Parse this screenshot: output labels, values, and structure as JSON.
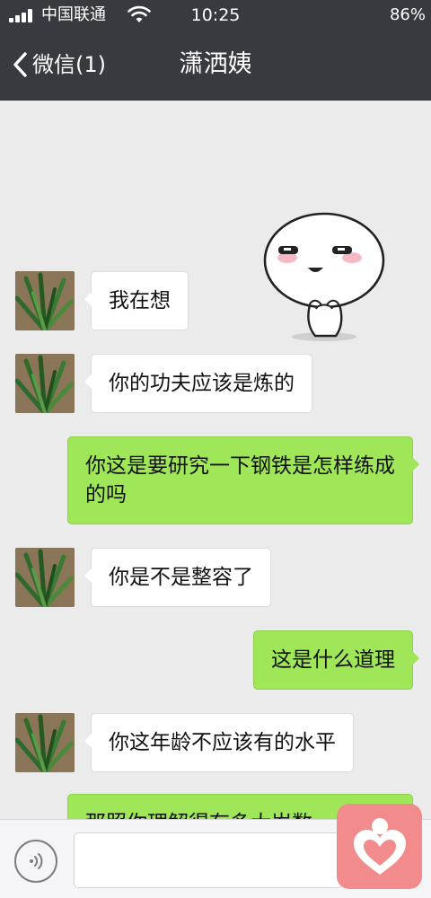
{
  "status_bar": {
    "carrier": "中国联通",
    "time": "10:25",
    "battery": "86%",
    "signal_icon": "signal-bars-icon",
    "wifi_icon": "wifi-icon"
  },
  "nav": {
    "back_label": "微信(1)",
    "title": "潇洒姨",
    "back_icon": "chevron-left-icon"
  },
  "messages": [
    {
      "side": "in",
      "text": "我在想"
    },
    {
      "side": "in",
      "text": "你的功夫应该是炼的"
    },
    {
      "side": "out",
      "text": "你这是要研究一下钢铁是怎样练成的吗"
    },
    {
      "side": "in",
      "text": "你是不是整容了"
    },
    {
      "side": "out",
      "text": "这是什么道理"
    },
    {
      "side": "in",
      "text": "你这年龄不应该有的水平"
    },
    {
      "side": "out",
      "text": "那照你理解得有多大岁数"
    }
  ],
  "sticker_icon": "blushing-dumpling-sticker",
  "input_bar": {
    "voice_icon": "voice-icon",
    "text_value": "",
    "badge_icon": "heart-person-icon"
  },
  "colors": {
    "nav_background": "#393a3f",
    "chat_background": "#ebebeb",
    "outgoing_bubble": "#9fe658",
    "incoming_bubble": "#ffffff",
    "badge": "#f28c8c"
  }
}
